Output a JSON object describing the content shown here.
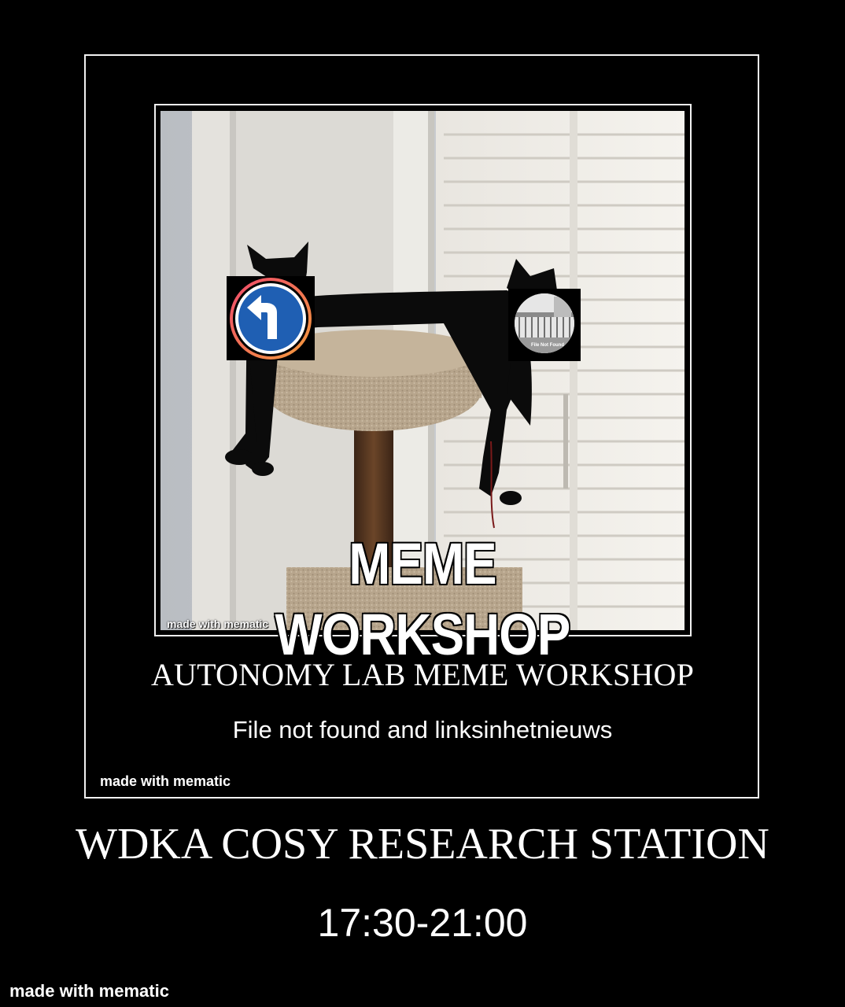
{
  "meme": {
    "caption": "MEME WORKSHOP",
    "photo_watermark": "made with mematic",
    "sticker_right_label": "File Not Found"
  },
  "inner_poster": {
    "title": "AUTONOMY LAB MEME WORKSHOP",
    "subtitle": "File not found and linksinhetnieuws",
    "watermark": "made with mematic"
  },
  "outer_poster": {
    "title": "WDKA COSY RESEARCH STATION",
    "time": "17:30-21:00",
    "watermark": "made with mematic"
  },
  "colors": {
    "background": "#000000",
    "frame": "#f2f2f2",
    "text": "#ffffff",
    "sign_blue": "#1f5fb3",
    "ring_gradient_start": "#f04b6b",
    "ring_gradient_end": "#f39a3c"
  },
  "icons": {
    "left_sticker": "turn-left-road-sign-icon",
    "right_sticker": "balcony-photo-icon"
  }
}
